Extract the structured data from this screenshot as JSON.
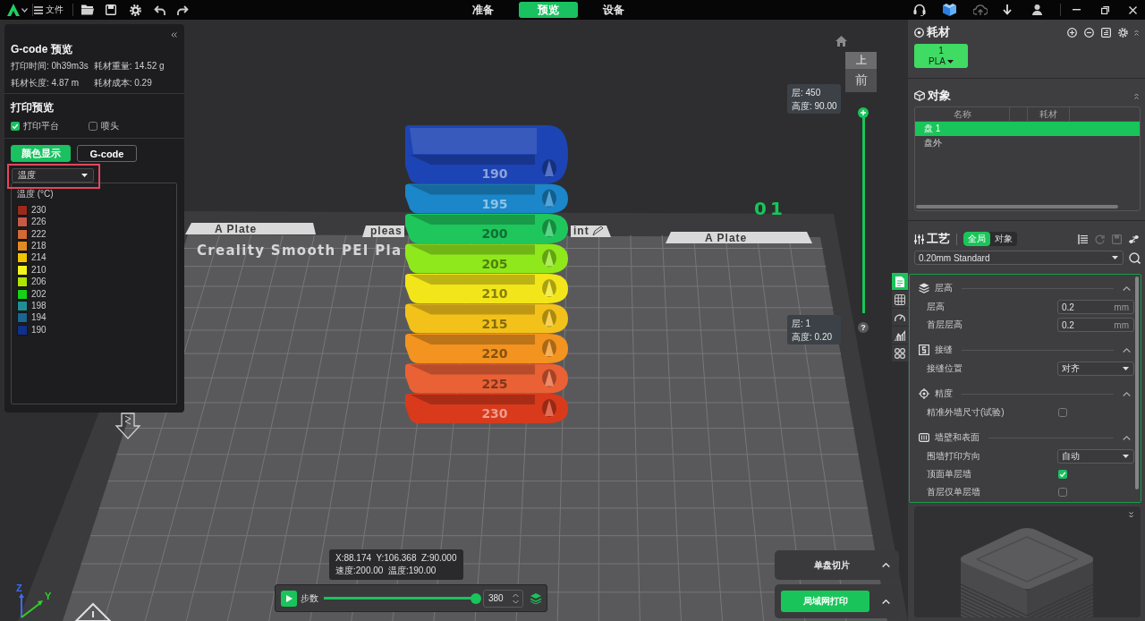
{
  "toolbar": {
    "menu_label": "文件",
    "tabs": [
      {
        "label": "准备",
        "selected": false
      },
      {
        "label": "预览",
        "selected": true
      },
      {
        "label": "设备",
        "selected": false
      }
    ]
  },
  "gcode_panel": {
    "title": "G-code 预览",
    "stats": [
      "打印时间: 0h39m3s",
      "耗材重量: 14.52 g",
      "耗材长度: 4.87 m",
      "耗材成本: 0.29"
    ],
    "print_preview": {
      "title": "打印预览",
      "options": [
        {
          "label": "打印平台",
          "checked": true
        },
        {
          "label": "喷头",
          "checked": false
        }
      ]
    },
    "view_tabs": [
      {
        "label": "颜色显示",
        "selected": true
      },
      {
        "label": "G-code",
        "selected": false
      }
    ],
    "color_mode": {
      "value": "温度",
      "highlighted": true
    },
    "legend": {
      "title": "温度 (°C)",
      "items": [
        {
          "label": "230",
          "color": "#9b2a1b"
        },
        {
          "label": "226",
          "color": "#c65a45"
        },
        {
          "label": "222",
          "color": "#d26a33"
        },
        {
          "label": "218",
          "color": "#e38b22"
        },
        {
          "label": "214",
          "color": "#f2c400"
        },
        {
          "label": "210",
          "color": "#f4f41c"
        },
        {
          "label": "206",
          "color": "#aee400"
        },
        {
          "label": "202",
          "color": "#16d216"
        },
        {
          "label": "198",
          "color": "#1f8f96"
        },
        {
          "label": "194",
          "color": "#1a6592"
        },
        {
          "label": "190",
          "color": "#11308b"
        }
      ]
    }
  },
  "viewport": {
    "plate": {
      "left_tab": "A Plate",
      "center_tab": [
        "pleas",
        "int"
      ],
      "right_tab": "A Plate",
      "type": "Creality Smooth PEI Pla",
      "number": "01"
    },
    "model": {
      "tiers": [
        {
          "label": "190",
          "color": "#1d44b4"
        },
        {
          "label": "195",
          "color": "#1b86c9"
        },
        {
          "label": "200",
          "color": "#1fc65c"
        },
        {
          "label": "205",
          "color": "#8fe81c"
        },
        {
          "label": "210",
          "color": "#f2e61a"
        },
        {
          "label": "215",
          "color": "#f3c21a"
        },
        {
          "label": "220",
          "color": "#f2941f"
        },
        {
          "label": "225",
          "color": "#ea6136"
        },
        {
          "label": "230",
          "color": "#d93a1c"
        }
      ]
    },
    "view_cube": {
      "top": "上",
      "front": "前"
    },
    "layer_slider": {
      "top": {
        "level": 1,
        "layer": "层: 450",
        "height": "高度: 90.00"
      },
      "bottom": {
        "layer": "层: 1",
        "height": "高度: 0.20"
      }
    },
    "help": "?",
    "axes": [
      "Z",
      "Y"
    ],
    "position_tip": [
      "X:88.174  Y:106.368  Z:90.000",
      "速度:200.00  温度:190.00"
    ],
    "playback": {
      "label": "步数",
      "level": 1,
      "value": "380"
    },
    "slice_panel": {
      "label": "单盘切片"
    },
    "print_button": {
      "label": "局域网打印"
    },
    "side_tabs": [
      {
        "selected": true
      },
      {
        "selected": false
      },
      {
        "selected": false
      },
      {
        "selected": false
      },
      {
        "selected": false
      }
    ]
  },
  "right_panel": {
    "filament": {
      "title": "耗材",
      "chips": [
        {
          "number": "1",
          "material": "PLA"
        }
      ]
    },
    "objects": {
      "title": "对象",
      "columns": [
        "名称",
        "耗材"
      ],
      "rows": [
        {
          "name": "盘 1",
          "selected": true
        },
        {
          "name": "盘外",
          "selected": false
        }
      ]
    },
    "process": {
      "title": "工艺",
      "scope_tabs": [
        {
          "label": "全局",
          "selected": true
        },
        {
          "label": "对象",
          "selected": false
        }
      ],
      "preset": "0.20mm Standard",
      "groups": [
        {
          "title": "层高",
          "expanded": true,
          "rows": [
            {
              "kind": "number",
              "label": "层高",
              "value": "0.2",
              "unit": "mm"
            },
            {
              "kind": "number",
              "label": "首层层高",
              "value": "0.2",
              "unit": "mm"
            }
          ]
        },
        {
          "title": "接缝",
          "expanded": true,
          "rows": [
            {
              "kind": "select",
              "label": "接缝位置",
              "value": "对齐"
            }
          ]
        },
        {
          "title": "精度",
          "expanded": true,
          "rows": [
            {
              "kind": "checkbox",
              "label": "精准外墙尺寸(试验)",
              "checked": false
            }
          ]
        },
        {
          "title": "墙壁和表面",
          "expanded": true,
          "rows": [
            {
              "kind": "select",
              "label": "围墙打印方向",
              "value": "自动"
            },
            {
              "kind": "checkbox",
              "label": "顶面单层墙",
              "checked": true
            },
            {
              "kind": "checkbox",
              "label": "首层仅单层墙",
              "checked": false
            }
          ]
        }
      ]
    }
  }
}
